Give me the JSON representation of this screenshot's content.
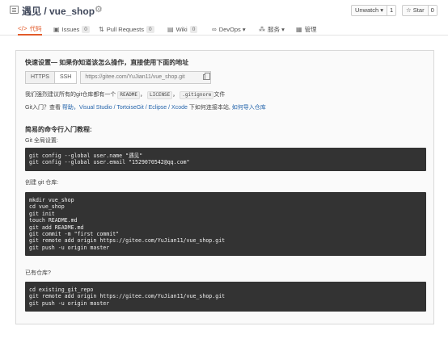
{
  "header": {
    "repo_title": "遇见 / vue_shop",
    "watch": {
      "label": "Unwatch ▾",
      "count": "1"
    },
    "star": {
      "label": "☆ Star",
      "count": "0"
    }
  },
  "tabs": [
    {
      "icon": "</>",
      "label": "代码",
      "badge": ""
    },
    {
      "icon": "▣",
      "label": "Issues",
      "badge": "0"
    },
    {
      "icon": "⇅",
      "label": "Pull Requests",
      "badge": "0"
    },
    {
      "icon": "▤",
      "label": "Wiki",
      "badge": "0"
    },
    {
      "icon": "∞",
      "label": "DevOps ▾",
      "badge": ""
    },
    {
      "icon": "⁂",
      "label": "服务 ▾",
      "badge": ""
    },
    {
      "icon": "▦",
      "label": "管理",
      "badge": ""
    }
  ],
  "quick": {
    "title": "快速设置— 如果你知道该怎么操作，直接使用下面的地址",
    "https_label": "HTTPS",
    "ssh_label": "SSH",
    "url": "https://gitee.com/YuJian11/vue_shop.git",
    "recommend_prefix": "我们强烈建议所有的git仓库都有一个",
    "readme": "README",
    "sep1": "，",
    "license": "LICENSE",
    "sep2": "，",
    "gitignore": ".gitignore",
    "recommend_suffix": "文件",
    "intro_prefix": "Git入门？查看 ",
    "intro_help": "帮助",
    "intro_tools": "，Visual Studio / TortoiseGit / Eclipse / Xcode",
    "intro_mid": " 下如何连接本站, ",
    "intro_import": "如何导入仓库"
  },
  "commands": {
    "title": "简易的命令行入门教程:",
    "global_label": "Git 全局设置:",
    "global_lines": [
      "git config --global user.name \"遇见\"",
      "git config --global user.email \"1529070542@qq.com\""
    ],
    "create_label": "创建 git 仓库:",
    "create_lines": [
      "mkdir vue_shop",
      "cd vue_shop",
      "git init",
      "touch README.md",
      "git add README.md",
      "git commit -m \"first commit\"",
      "git remote add origin https://gitee.com/YuJian11/vue_shop.git",
      "git push -u origin master"
    ],
    "existing_label": "已有仓库?",
    "existing_lines": [
      "cd existing_git_repo",
      "git remote add origin https://gitee.com/YuJian11/vue_shop.git",
      "git push -u origin master"
    ]
  }
}
